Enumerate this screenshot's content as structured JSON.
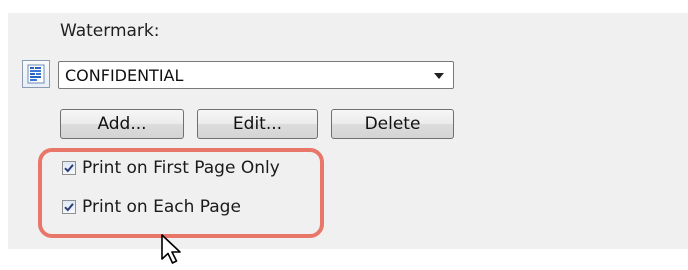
{
  "watermark": {
    "label": "Watermark:",
    "selected_value": "CONFIDENTIAL",
    "icon": "watermark-document-icon"
  },
  "buttons": {
    "add": "Add...",
    "edit": "Edit...",
    "delete": "Delete"
  },
  "options": [
    {
      "label": "Print on First Page Only",
      "checked": true
    },
    {
      "label": "Print on Each Page",
      "checked": true
    }
  ],
  "highlight": {
    "color": "#e8776a"
  },
  "pointer": {
    "icon": "arrow-cursor-icon"
  }
}
